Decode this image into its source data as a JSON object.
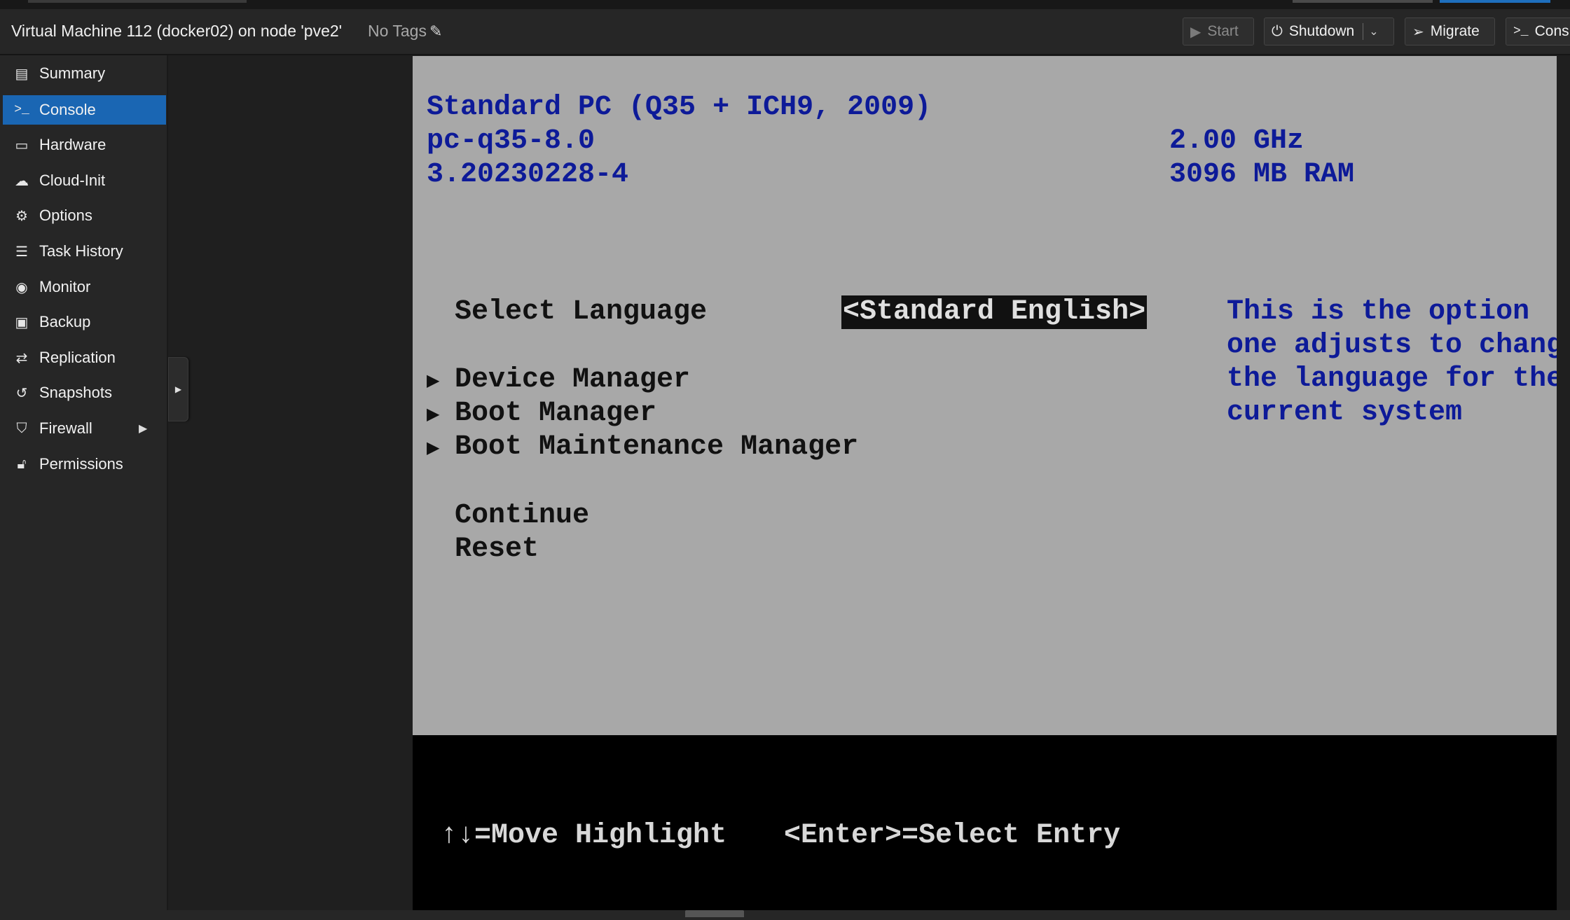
{
  "header": {
    "title": "Virtual Machine 112 (docker02) on node 'pve2'",
    "tags": "No Tags",
    "buttons": {
      "start": "Start",
      "shutdown": "Shutdown",
      "migrate": "Migrate",
      "console": "Cons"
    }
  },
  "sidebar": {
    "items": [
      {
        "label": "Summary",
        "icon": "book-icon"
      },
      {
        "label": "Console",
        "icon": "terminal-icon",
        "active": true
      },
      {
        "label": "Hardware",
        "icon": "monitor-icon"
      },
      {
        "label": "Cloud-Init",
        "icon": "cloud-icon"
      },
      {
        "label": "Options",
        "icon": "gear-icon"
      },
      {
        "label": "Task History",
        "icon": "list-icon"
      },
      {
        "label": "Monitor",
        "icon": "eye-icon"
      },
      {
        "label": "Backup",
        "icon": "floppy-icon"
      },
      {
        "label": "Replication",
        "icon": "retweet-icon"
      },
      {
        "label": "Snapshots",
        "icon": "history-icon"
      },
      {
        "label": "Firewall",
        "icon": "shield-icon"
      },
      {
        "label": "Permissions",
        "icon": "unlock-icon"
      }
    ]
  },
  "console": {
    "machine": "Standard PC (Q35 + ICH9, 2009)",
    "machine_type": "pc-q35-8.0",
    "firmware_version": "3.20230228-4",
    "cpu_speed": "2.00 GHz",
    "ram": "3096 MB RAM",
    "select_language_label": "Select Language",
    "language_value": "<Standard English>",
    "menu": [
      "Device Manager",
      "Boot Manager",
      "Boot Maintenance Manager"
    ],
    "actions": [
      "Continue",
      "Reset"
    ],
    "help_lines": [
      "This is the option",
      "one adjusts to change",
      "the language for the",
      "current system"
    ],
    "footer_move": "↑↓=Move Highlight",
    "footer_select": "<Enter>=Select Entry",
    "colors": {
      "bios_bg": "#a8a8a8",
      "bios_blue": "#0d1a98",
      "accent": "#1a66b3"
    }
  }
}
